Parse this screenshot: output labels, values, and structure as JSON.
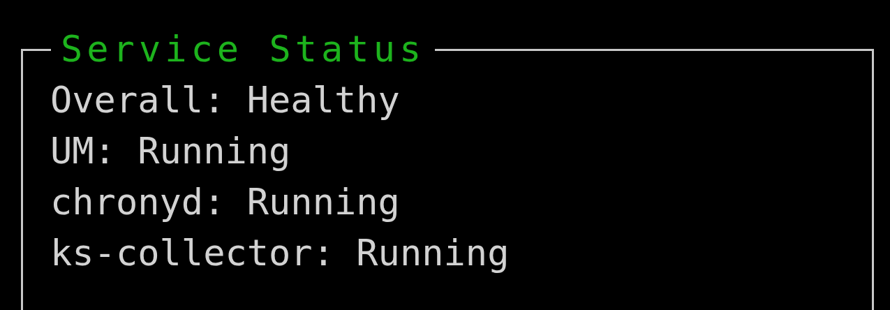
{
  "panel": {
    "title": "Service Status",
    "lines": [
      "Overall: Healthy",
      "UM: Running",
      "chronyd: Running",
      "ks-collector: Running"
    ]
  }
}
